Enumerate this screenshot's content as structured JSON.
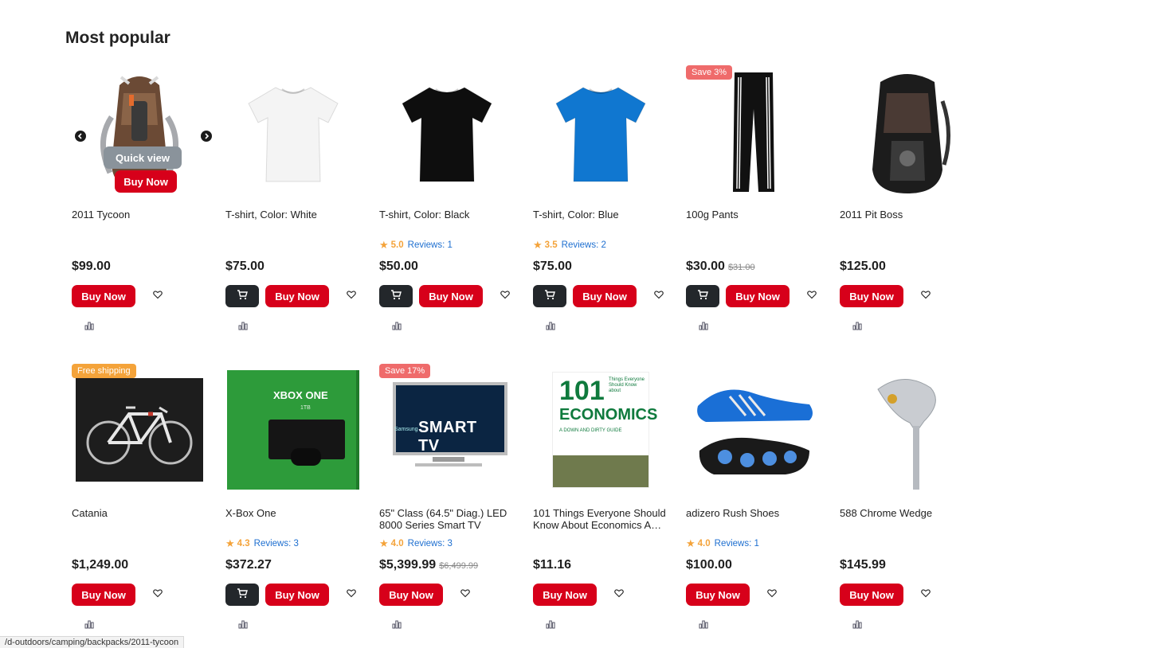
{
  "section": {
    "title": "Most popular"
  },
  "status_url": "d-outdoors/camping/backpacks/2011-tycoon/",
  "overlay": {
    "quick_view": "Quick view",
    "buy_now": "Buy Now"
  },
  "labels": {
    "buy_now": "Buy Now"
  },
  "products": [
    {
      "name": "2011 Tycoon",
      "price": "$99.00",
      "image": "backpack-brown",
      "cart": false
    },
    {
      "name": "T-shirt, Color: White",
      "price": "$75.00",
      "image": "tshirt-white",
      "cart": true
    },
    {
      "name": "T-shirt, Color: Black",
      "price": "$50.00",
      "rating": "5.0",
      "reviews": "Reviews: 1",
      "image": "tshirt-black",
      "cart": true
    },
    {
      "name": "T-shirt, Color: Blue",
      "price": "$75.00",
      "rating": "3.5",
      "reviews": "Reviews: 2",
      "image": "tshirt-blue",
      "cart": true
    },
    {
      "name": "100g Pants",
      "price": "$30.00",
      "old_price": "$31.00",
      "badge": "Save 3%",
      "badge_type": "save",
      "image": "pants",
      "cart": true
    },
    {
      "name": "2011 Pit Boss",
      "price": "$125.00",
      "image": "backpack-black",
      "cart": false
    },
    {
      "name": "Catania",
      "price": "$1,249.00",
      "badge": "Free shipping",
      "badge_type": "ship",
      "image": "bike",
      "cart": false
    },
    {
      "name": "X-Box One",
      "price": "$372.27",
      "rating": "4.3",
      "reviews": "Reviews: 3",
      "image": "xbox",
      "cart": true
    },
    {
      "name": "65\" Class (64.5\" Diag.) LED 8000 Series Smart TV",
      "price": "$5,399.99",
      "old_price": "$6,499.99",
      "rating": "4.0",
      "reviews": "Reviews: 3",
      "badge": "Save 17%",
      "badge_type": "save",
      "image": "tv",
      "cart": false
    },
    {
      "name": "101 Things Everyone Should Know About Economics A…",
      "price": "$11.16",
      "image": "book",
      "cart": false
    },
    {
      "name": "adizero Rush Shoes",
      "price": "$100.00",
      "rating": "4.0",
      "reviews": "Reviews: 1",
      "image": "shoes",
      "cart": false
    },
    {
      "name": "588 Chrome Wedge",
      "price": "$145.99",
      "image": "wedge",
      "cart": false
    }
  ],
  "image_text": {
    "xbox_logo": "XBOX ONE",
    "xbox_sub": "1TB",
    "tv_brand": "Samsung",
    "tv_text": "SMART TV",
    "book_num": "101",
    "book_title": "ECONOMICS",
    "book_side": "Things Everyone Should Know about",
    "book_sub": "A DOWN AND DIRTY GUIDE"
  },
  "colors": {
    "buy": "#d7001a",
    "cart": "#23272b",
    "star": "#f4a33a",
    "reviews": "#1e6fd0",
    "save_badge": "#ef6b6b",
    "ship_badge": "#f4a33a"
  }
}
